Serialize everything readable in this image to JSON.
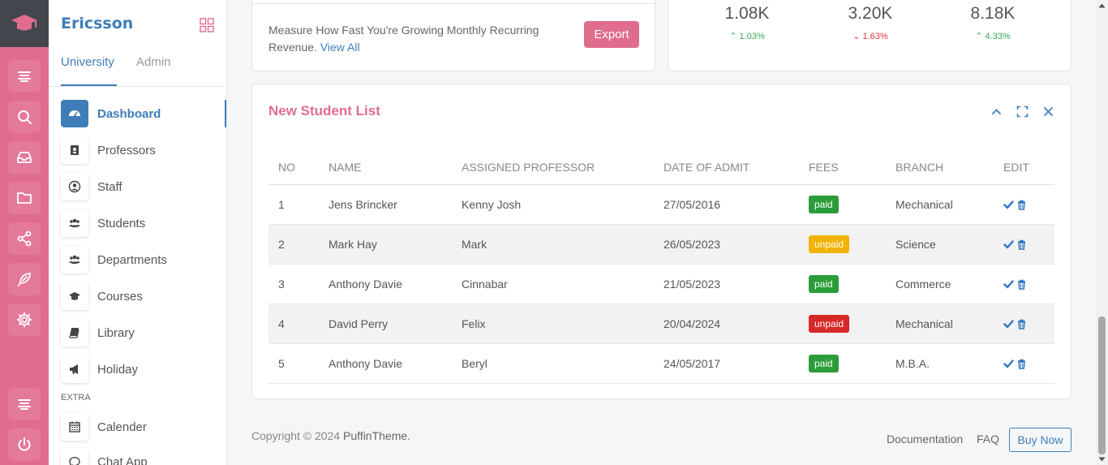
{
  "app": {
    "brand": "Ericsson",
    "colors": {
      "accent": "#3f7db9",
      "rail": "#e06d8e",
      "success": "#2a9d3a",
      "warning": "#f0b400",
      "danger": "#d62828"
    }
  },
  "rail": {
    "icons": [
      "graduation-cap-icon",
      "menu-lines-icon",
      "search-icon",
      "inbox-icon",
      "folder-icon",
      "share-icon",
      "feather-icon",
      "gear-icon",
      "menu-lines-icon",
      "power-icon"
    ]
  },
  "sidebar": {
    "tabs": [
      {
        "label": "University",
        "active": true
      },
      {
        "label": "Admin",
        "active": false
      }
    ],
    "items": [
      {
        "label": "Dashboard",
        "icon": "dashboard-icon",
        "active": true
      },
      {
        "label": "Professors",
        "icon": "id-badge-icon"
      },
      {
        "label": "Staff",
        "icon": "user-circle-icon"
      },
      {
        "label": "Students",
        "icon": "users-icon"
      },
      {
        "label": "Departments",
        "icon": "users-icon"
      },
      {
        "label": "Courses",
        "icon": "graduation-cap-icon"
      },
      {
        "label": "Library",
        "icon": "book-icon"
      },
      {
        "label": "Holiday",
        "icon": "bullhorn-icon"
      }
    ],
    "section_label": "EXTRA",
    "extra_items": [
      {
        "label": "Calender",
        "icon": "calendar-icon"
      },
      {
        "label": "Chat App",
        "icon": "chat-icon"
      }
    ]
  },
  "revenue_card": {
    "text": "Measure How Fast You're Growing Monthly Recurring Revenue.",
    "link": "View All",
    "export_label": "Export"
  },
  "stats_card": {
    "stats": [
      {
        "value": "1.08K",
        "change": "1.03%",
        "direction": "up"
      },
      {
        "value": "3.20K",
        "change": "1.63%",
        "direction": "down"
      },
      {
        "value": "8.18K",
        "change": "4.33%",
        "direction": "up"
      }
    ]
  },
  "student_list": {
    "title": "New Student List",
    "columns": [
      "NO",
      "NAME",
      "ASSIGNED PROFESSOR",
      "DATE OF ADMIT",
      "FEES",
      "BRANCH",
      "EDIT"
    ],
    "rows": [
      {
        "no": "1",
        "name": "Jens Brincker",
        "professor": "Kenny Josh",
        "date": "27/05/2016",
        "fees": "paid",
        "fee_style": "paid",
        "branch": "Mechanical"
      },
      {
        "no": "2",
        "name": "Mark Hay",
        "professor": "Mark",
        "date": "26/05/2023",
        "fees": "unpaid",
        "fee_style": "unpaid-w",
        "branch": "Science"
      },
      {
        "no": "3",
        "name": "Anthony Davie",
        "professor": "Cinnabar",
        "date": "21/05/2023",
        "fees": "paid",
        "fee_style": "paid",
        "branch": "Commerce"
      },
      {
        "no": "4",
        "name": "David Perry",
        "professor": "Felix",
        "date": "20/04/2024",
        "fees": "unpaid",
        "fee_style": "unpaid-d",
        "branch": "Mechanical"
      },
      {
        "no": "5",
        "name": "Anthony Davie",
        "professor": "Beryl",
        "date": "24/05/2017",
        "fees": "paid",
        "fee_style": "paid",
        "branch": "M.B.A."
      }
    ]
  },
  "footer": {
    "copyright": "Copyright © 2024",
    "brand": "PuffinTheme.",
    "links": [
      "Documentation",
      "FAQ"
    ],
    "buy_label": "Buy Now"
  }
}
